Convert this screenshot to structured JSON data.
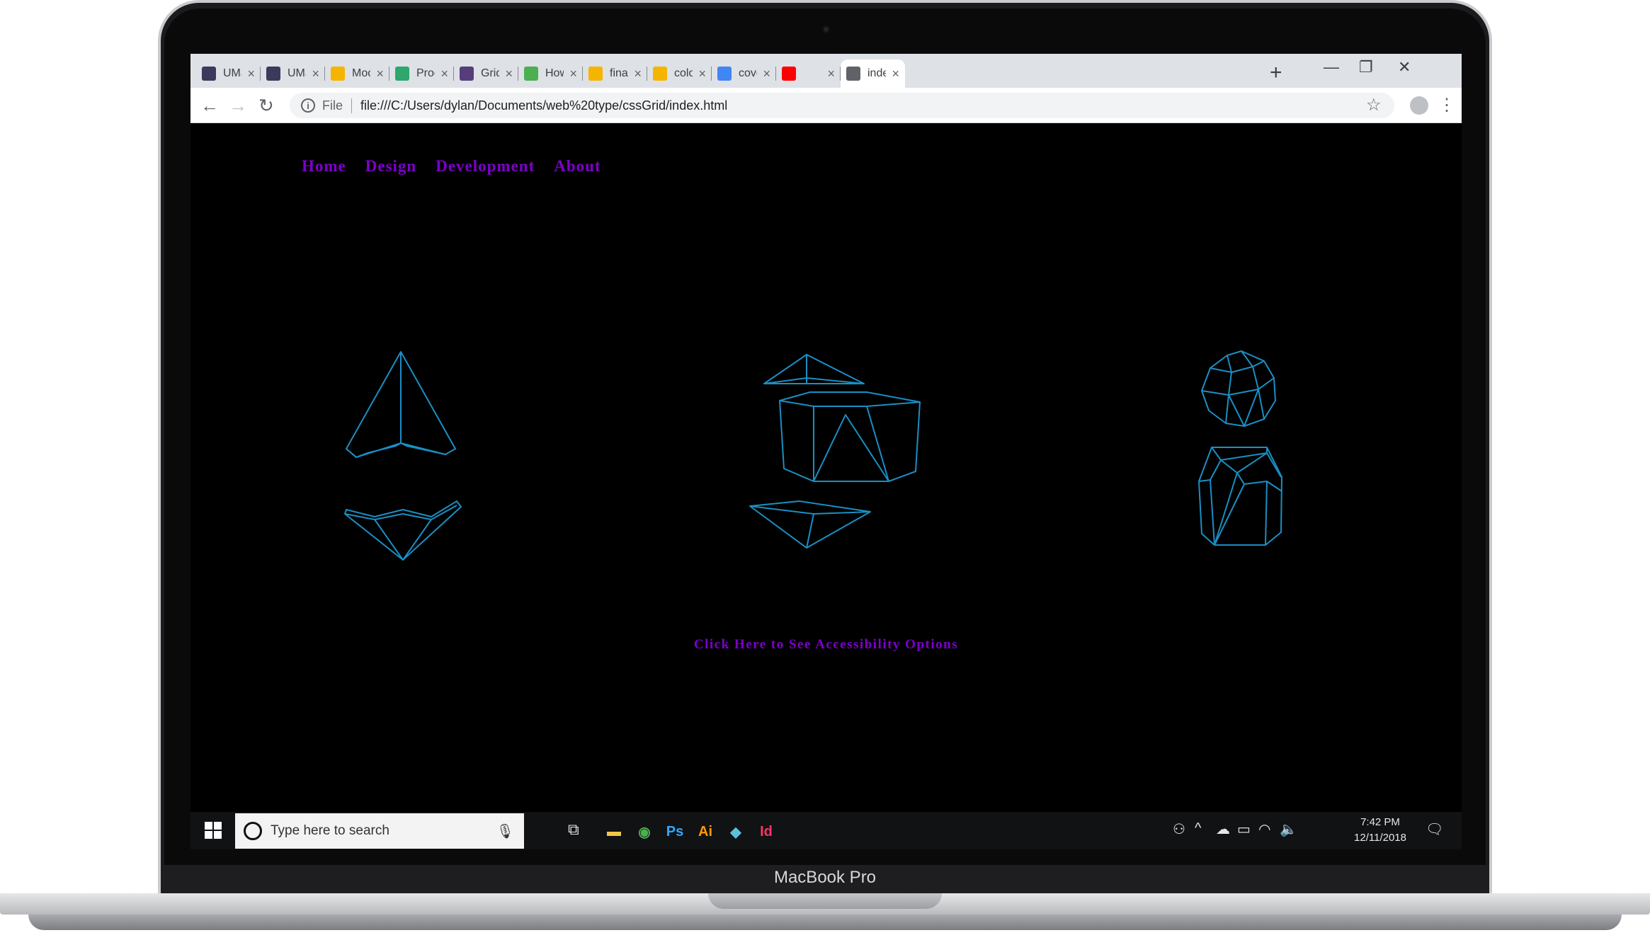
{
  "device": {
    "label": "MacBook Pro"
  },
  "browser": {
    "tabs": [
      {
        "title": "UMass",
        "icon": "umass-icon",
        "color": "#3a3a5c"
      },
      {
        "title": "UMass",
        "icon": "umass-icon",
        "color": "#3a3a5c"
      },
      {
        "title": "Mock U",
        "icon": "google-drive-icon",
        "color": "#f4b400"
      },
      {
        "title": "Produc",
        "icon": "product-icon",
        "color": "#2ea66c"
      },
      {
        "title": "Grid Te",
        "icon": "bootstrap-icon",
        "color": "#563d7c"
      },
      {
        "title": "How To",
        "icon": "w3schools-icon",
        "color": "#4caf50"
      },
      {
        "title": "final - C",
        "icon": "google-drive-icon",
        "color": "#f4b400"
      },
      {
        "title": "color th",
        "icon": "google-drive-icon",
        "color": "#f4b400"
      },
      {
        "title": "cover le",
        "icon": "google-docs-icon",
        "color": "#4285f4"
      },
      {
        "title": "",
        "icon": "youtube-icon",
        "color": "#ff0000"
      },
      {
        "title": "index.h",
        "icon": "file-icon",
        "color": "#5f6368",
        "active": true
      }
    ],
    "new_tab_symbol": "+",
    "close_symbol": "×",
    "window_controls": {
      "minimize": "—",
      "restore": "❐",
      "close": "✕"
    },
    "scheme_label": "File",
    "url": "file:///C:/Users/dylan/Documents/web%20type/cssGrid/index.html",
    "nav_icons": {
      "back": "←",
      "forward": "→",
      "reload": "↻"
    },
    "bookmark_icon": "☆",
    "menu_icon": "⋮"
  },
  "page": {
    "nav": [
      "Home",
      "Design",
      "Development",
      "About"
    ],
    "accessibility_link": "Click Here to See Accessibility Options",
    "colors": {
      "link": "#7d00cc",
      "wireframe": "#1a8fc4",
      "background": "#000000"
    }
  },
  "taskbar": {
    "search_placeholder": "Type here to search",
    "apps": [
      {
        "name": "file-explorer-icon",
        "label": "▬",
        "color": "#f2c744"
      },
      {
        "name": "chrome-icon",
        "label": "◉",
        "color": "#4caf50"
      },
      {
        "name": "photoshop-icon",
        "label": "Ps",
        "color": "#31a8ff"
      },
      {
        "name": "illustrator-icon",
        "label": "Ai",
        "color": "#ff9a00"
      },
      {
        "name": "gitkraken-icon",
        "label": "◆",
        "color": "#5bc0de"
      },
      {
        "name": "indesign-icon",
        "label": "Id",
        "color": "#ff3366"
      }
    ],
    "time": "7:42 PM",
    "date": "12/11/2018"
  }
}
